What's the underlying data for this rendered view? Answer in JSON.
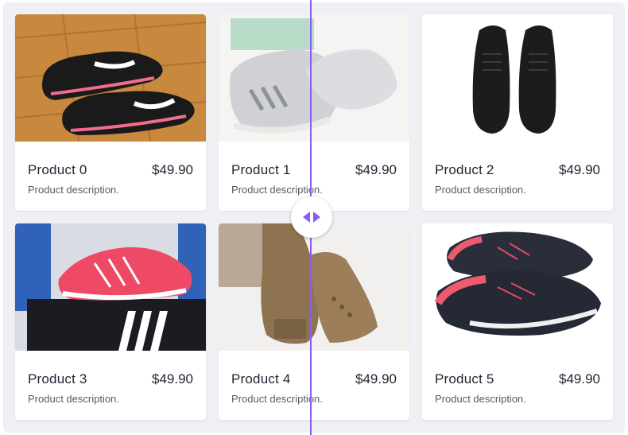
{
  "products": [
    {
      "name": "Product 0",
      "price": "$49.90",
      "description": "Product description.",
      "image": "black-white-running-shoes-on-wood-floor"
    },
    {
      "name": "Product 1",
      "price": "$49.90",
      "description": "Product description.",
      "image": "silver-sneakers-with-box"
    },
    {
      "name": "Product 2",
      "price": "$49.90",
      "description": "Product description.",
      "image": "black-leather-sneakers"
    },
    {
      "name": "Product 3",
      "price": "$49.90",
      "description": "Product description.",
      "image": "pink-running-shoe-on-box"
    },
    {
      "name": "Product 4",
      "price": "$49.90",
      "description": "Product description.",
      "image": "tan-wedge-ankle-boots"
    },
    {
      "name": "Product 5",
      "price": "$49.90",
      "description": "Product description.",
      "image": "black-pink-tennis-shoes"
    }
  ],
  "colors": {
    "accent": "#8a5cf6",
    "background": "#eef0f3",
    "card": "#ffffff",
    "text": "#1f2430"
  }
}
